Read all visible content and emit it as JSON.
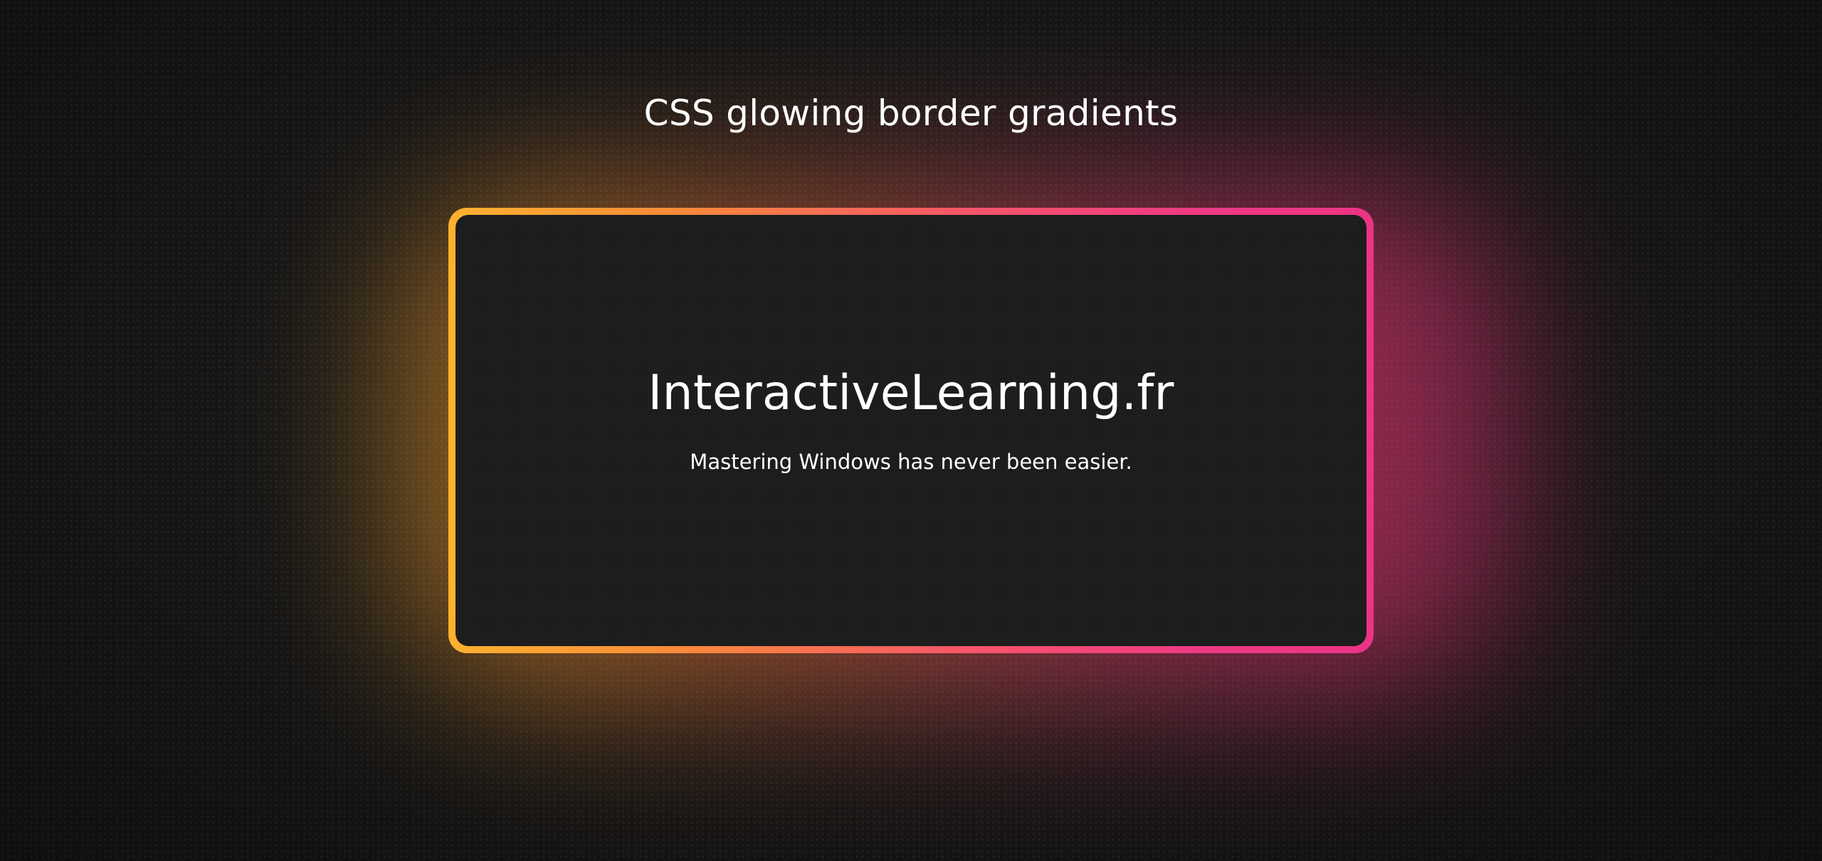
{
  "page": {
    "heading": "CSS glowing border gradients"
  },
  "card": {
    "title": "InteractiveLearning.fr",
    "subtitle": "Mastering Windows has never been easier."
  },
  "colors": {
    "background": "#171717",
    "card_background": "#1c1c1c",
    "gradient_start": "#fdb22f",
    "gradient_end": "#ec3484",
    "text": "#ffffff"
  }
}
